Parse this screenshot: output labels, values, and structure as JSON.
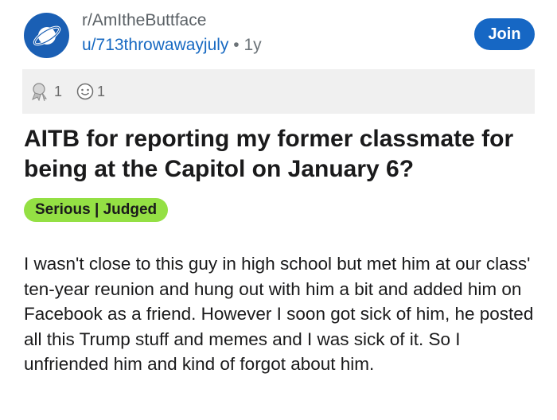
{
  "post": {
    "subreddit": "r/AmItheButtface",
    "author": "u/713throwawayjuly",
    "separator": "•",
    "age": "1y",
    "join_label": "Join",
    "awards": [
      {
        "icon": "silver-award-icon",
        "count": "1"
      },
      {
        "icon": "wholesome-award-icon",
        "count": "1"
      }
    ],
    "title": "AITB for reporting my former classmate for being at the Capitol on January 6?",
    "flair": "Serious | Judged",
    "body": "I wasn't close to this guy in high school but met him at our class' ten-year reunion and hung out with him a bit and added him on Facebook as a friend. However I soon got sick of him, he posted all this Trump stuff and memes and I was sick of it. So I unfriended him and kind of forgot about him."
  },
  "colors": {
    "accent": "#1667c4",
    "avatar": "#1a5fb4",
    "flair_bg": "#94e044",
    "award_bar": "#f0f0f0"
  }
}
